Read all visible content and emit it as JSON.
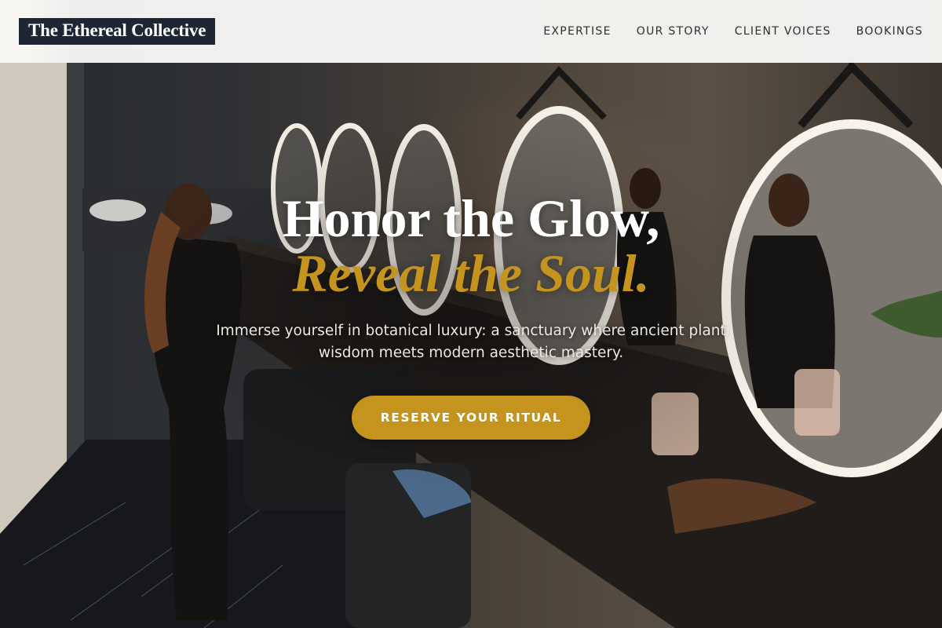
{
  "brand": {
    "name": "The Ethereal Collective"
  },
  "nav": {
    "items": [
      {
        "label": "EXPERTISE"
      },
      {
        "label": "OUR STORY"
      },
      {
        "label": "CLIENT VOICES"
      },
      {
        "label": "BOOKINGS"
      }
    ]
  },
  "hero": {
    "headline_line1": "Honor the Glow,",
    "headline_line2": "Reveal the Soul.",
    "subtitle": "Immerse yourself in botanical luxury: a sanctuary where ancient plant wisdom meets modern aesthetic mastery.",
    "cta_label": "RESERVE YOUR RITUAL"
  },
  "colors": {
    "accent_gold": "#c4941e",
    "logo_background": "#1e2633",
    "header_background": "#f8f7f5",
    "nav_text": "#2e2e33",
    "headline_white": "#ffffff"
  }
}
